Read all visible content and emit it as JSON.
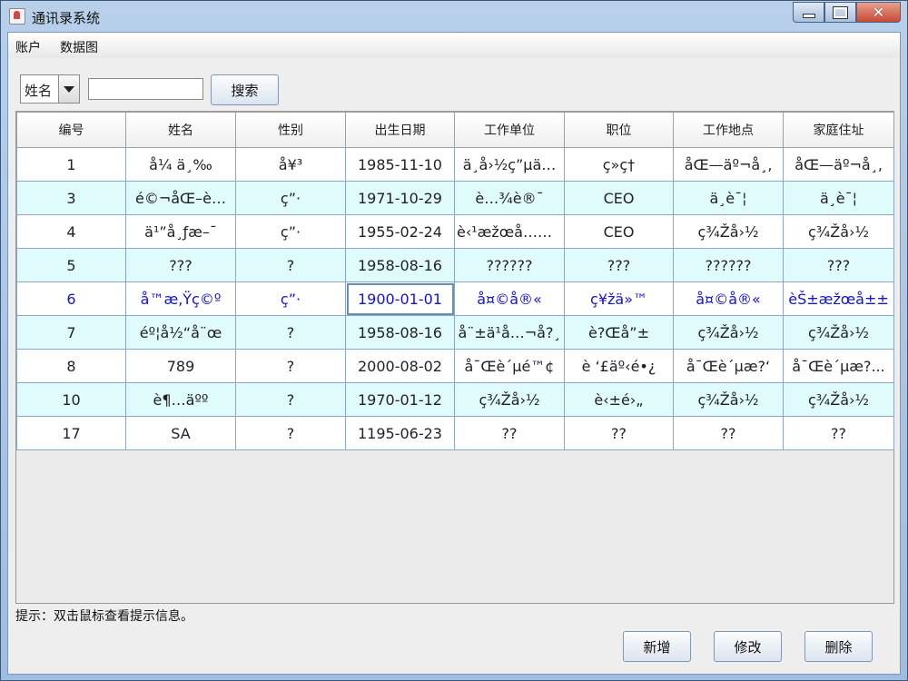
{
  "window": {
    "title": "通讯录系统",
    "controls": {
      "minimize": "—",
      "maximize": "□",
      "close": "✕"
    }
  },
  "menu": [
    "账户",
    "数据图"
  ],
  "search": {
    "field_selected": "姓名",
    "input_value": "",
    "button_label": "搜索"
  },
  "table": {
    "columns": [
      "编号",
      "姓名",
      "性别",
      "出生日期",
      "工作单位",
      "职位",
      "工作地点",
      "家庭住址"
    ],
    "rows": [
      [
        "1",
        "å¼ ä¸‰",
        "å¥³",
        "1985-11-10",
        "ä¸­å›½ç”µä…",
        "ç»ç†",
        "åŒ—äº¬å¸‚",
        "åŒ—äº¬å¸‚"
      ],
      [
        "3",
        "é©¬åŒ–è…",
        "ç”·",
        "1971-10-29",
        "è…¾è®¯",
        "CEO",
        "ä¸è¯¦",
        "ä¸è¯¦"
      ],
      [
        "4",
        "ä¹”å¸ƒæ–¯",
        "ç”·",
        "1955-02-24",
        "è‹¹æžœå…¬å¸",
        "CEO",
        "ç¾Žå›½",
        "ç¾Žå›½"
      ],
      [
        "5",
        "???",
        "?",
        "1958-08-16",
        "??????",
        "???",
        "??????",
        "???"
      ],
      [
        "6",
        "å­™æ‚Ÿç©º",
        "ç”·",
        "1900-01-01",
        "å¤©å®«",
        "ç¥žä»™",
        "å¤©å®«",
        "èŠ±æžœå±±"
      ],
      [
        "7",
        "éº¦å½“å¨œ",
        "?",
        "1958-08-16",
        "å¨±ä¹å…¬å?¸",
        "è?Œå”±",
        "ç¾Žå›½",
        "ç¾Žå›½"
      ],
      [
        "8",
        "789",
        "?",
        "2000-08-02",
        "å¯Œè´µé™¢",
        "è ‘£äº‹é•¿",
        "å¯Œè´µæ?‘",
        "å¯Œè´µæ?..."
      ],
      [
        "10",
        "è¶…äºº",
        "?",
        "1970-01-12",
        "ç¾Žå›½",
        "è‹±é›„",
        "ç¾Žå›½",
        "ç¾Žå›½"
      ],
      [
        "17",
        "SA",
        "?",
        "1195-06-23",
        "??",
        "??",
        "??",
        "??"
      ]
    ]
  },
  "hint": "提示：双击鼠标查看提示信息。",
  "actions": {
    "add": "新增",
    "edit": "修改",
    "delete": "删除"
  },
  "colors": {
    "selected_text": "#1515d0",
    "alt_row": "#e0fbfb"
  }
}
